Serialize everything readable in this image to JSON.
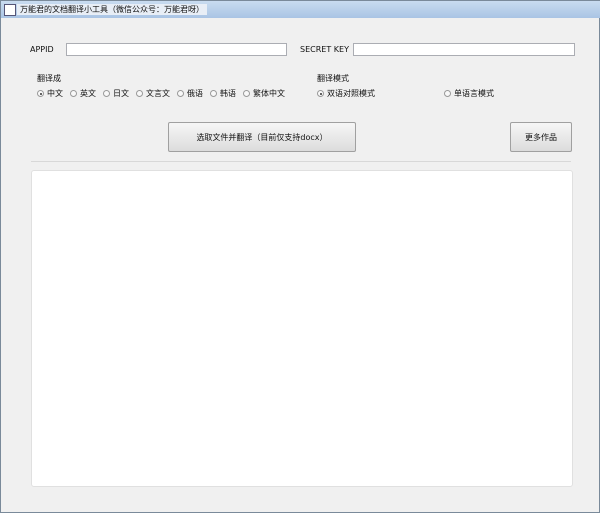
{
  "window": {
    "title": "万能君的文档翻译小工具（微信公众号：万能君呀）"
  },
  "form": {
    "appid_label": "APPID",
    "appid_value": "",
    "secret_label": "SECRET KEY",
    "secret_value": ""
  },
  "lang": {
    "label": "翻译成",
    "options": [
      "中文",
      "英文",
      "日文",
      "文言文",
      "俄语",
      "韩语",
      "繁体中文"
    ],
    "selected": 0
  },
  "mode": {
    "label": "翻译模式",
    "options": [
      "双语对照模式",
      "单语言模式"
    ],
    "selected": 0
  },
  "buttons": {
    "translate": "选取文件并翻译（目前仅支持docx）",
    "more": "更多作品"
  },
  "output": {
    "text": ""
  }
}
